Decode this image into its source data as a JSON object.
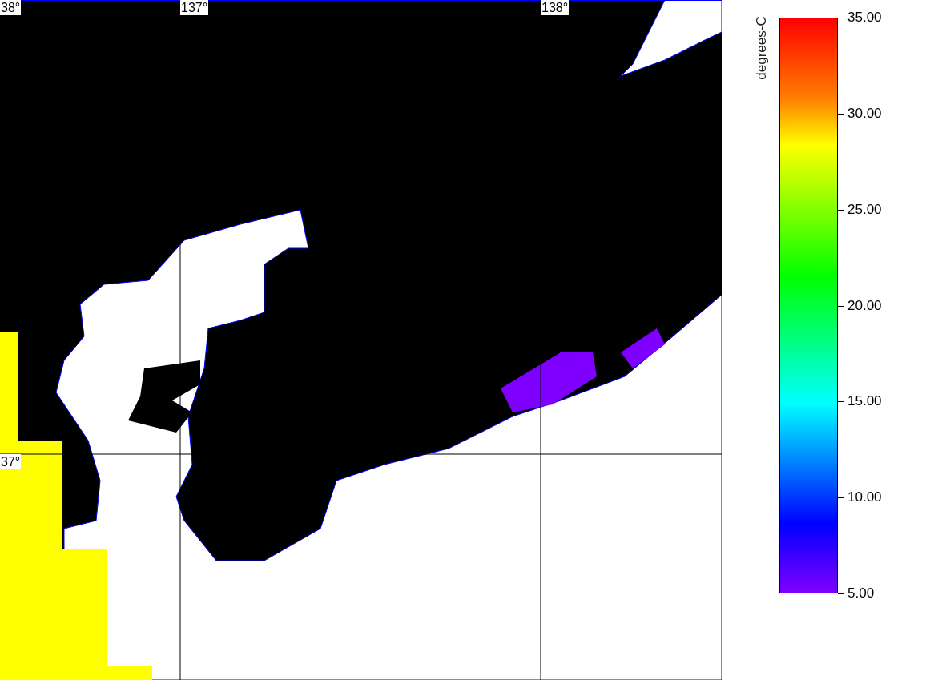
{
  "map": {
    "latitude_labels": [
      "38°",
      "37°"
    ],
    "longitude_labels": [
      "137°",
      "138°"
    ]
  },
  "colorbar": {
    "title": "degrees-C",
    "ticks": [
      "35.00",
      "30.00",
      "25.00",
      "20.00",
      "15.00",
      "10.00",
      "5.00"
    ]
  }
}
